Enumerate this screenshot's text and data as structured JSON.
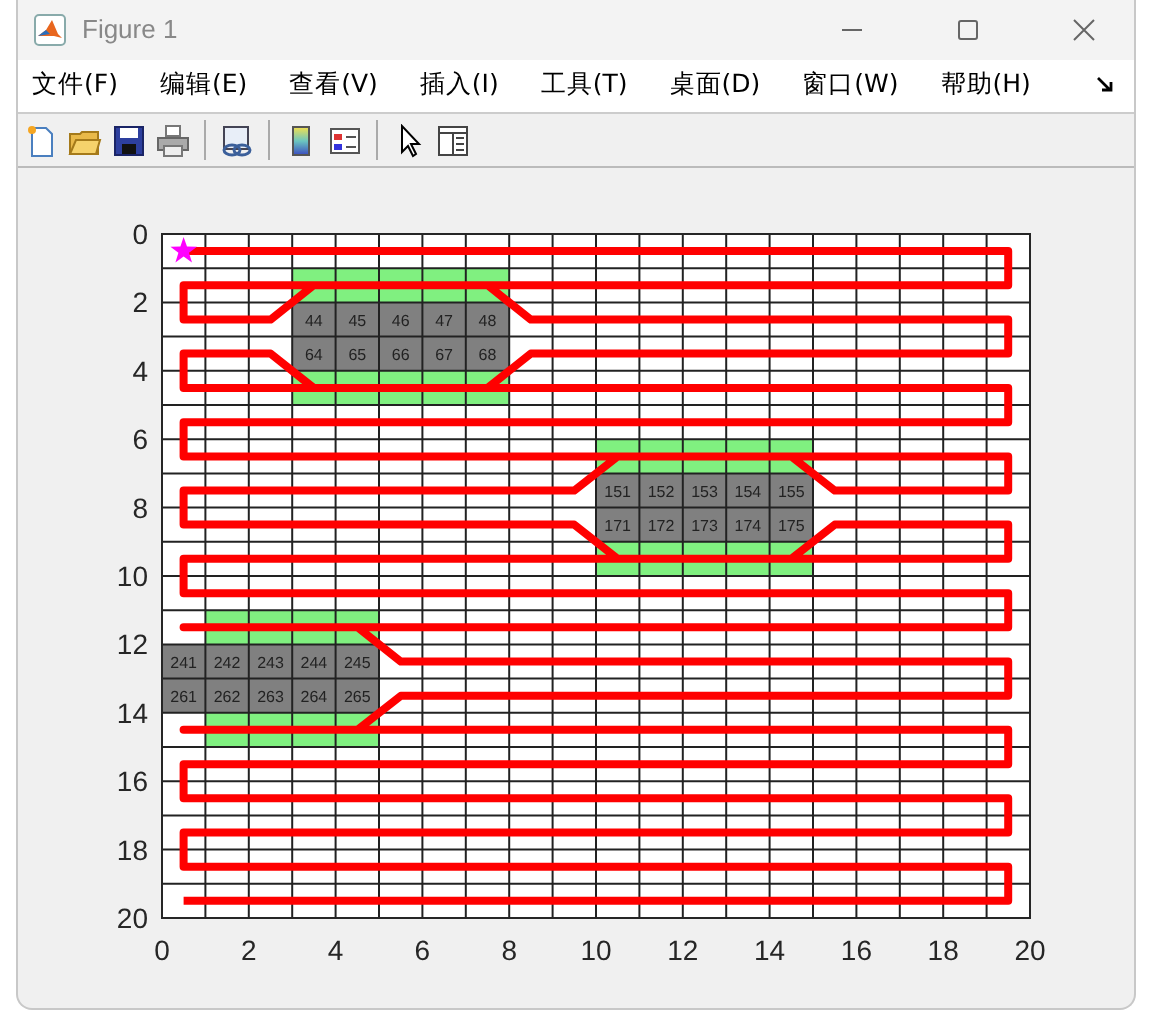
{
  "window": {
    "title": "Figure 1"
  },
  "menu": [
    "文件(F)",
    "编辑(E)",
    "查看(V)",
    "插入(I)",
    "工具(T)",
    "桌面(D)",
    "窗口(W)",
    "帮助(H)"
  ],
  "plot": {
    "chart_data": {
      "type": "line",
      "xlim": [
        0,
        20
      ],
      "ylim": [
        20,
        0
      ],
      "xticks": [
        0,
        2,
        4,
        6,
        8,
        10,
        12,
        14,
        16,
        18,
        20
      ],
      "yticks": [
        0,
        2,
        4,
        6,
        8,
        10,
        12,
        14,
        16,
        18,
        20
      ],
      "x": [
        0.5,
        19.5,
        19.5,
        0.5,
        0.5,
        2.5,
        3.5,
        7.5,
        8.5,
        19.5,
        19.5,
        8.5,
        7.5,
        3.5,
        2.5,
        0.5,
        0.5,
        19.5,
        19.5,
        0.5,
        0.5,
        19.5,
        19.5,
        15.5,
        14.5,
        10.5,
        9.5,
        0.5,
        0.5,
        9.5,
        10.5,
        14.5,
        15.5,
        19.5,
        19.5,
        0.5,
        0.5,
        19.5,
        19.5,
        0.5,
        4.5,
        5.5,
        19.5,
        19.5,
        5.5,
        4.5,
        0.5,
        19.5,
        19.5,
        0.5,
        0.5,
        19.5,
        19.5,
        0.5,
        0.5,
        19.5,
        19.5,
        0.5
      ],
      "grid": true,
      "series": [
        {
          "color": "#ff0000",
          "values": [
            0.5,
            0.5,
            1.5,
            1.5,
            2.5,
            2.5,
            1.5,
            1.5,
            2.5,
            2.5,
            3.5,
            3.5,
            4.5,
            4.5,
            3.5,
            3.5,
            4.5,
            4.5,
            5.5,
            5.5,
            6.5,
            6.5,
            7.5,
            7.5,
            6.5,
            6.5,
            7.5,
            7.5,
            8.5,
            8.5,
            9.5,
            9.5,
            8.5,
            8.5,
            9.5,
            9.5,
            10.5,
            10.5,
            11.5,
            11.5,
            11.5,
            12.5,
            12.5,
            13.5,
            13.5,
            14.5,
            14.5,
            14.5,
            15.5,
            15.5,
            16.5,
            16.5,
            17.5,
            17.5,
            18.5,
            18.5,
            19.5,
            19.5
          ]
        }
      ]
    },
    "obstacles": [
      {
        "cells": [
          [
            "44",
            "45",
            "46",
            "47",
            "48"
          ],
          [
            "64",
            "65",
            "66",
            "67",
            "68"
          ]
        ]
      },
      {
        "cells": [
          [
            "151",
            "152",
            "153",
            "154",
            "155"
          ],
          [
            "171",
            "172",
            "173",
            "174",
            "175"
          ]
        ]
      },
      {
        "cells": [
          [
            "241",
            "242",
            "243",
            "244",
            "245"
          ],
          [
            "261",
            "262",
            "263",
            "264",
            "265"
          ]
        ]
      }
    ]
  }
}
